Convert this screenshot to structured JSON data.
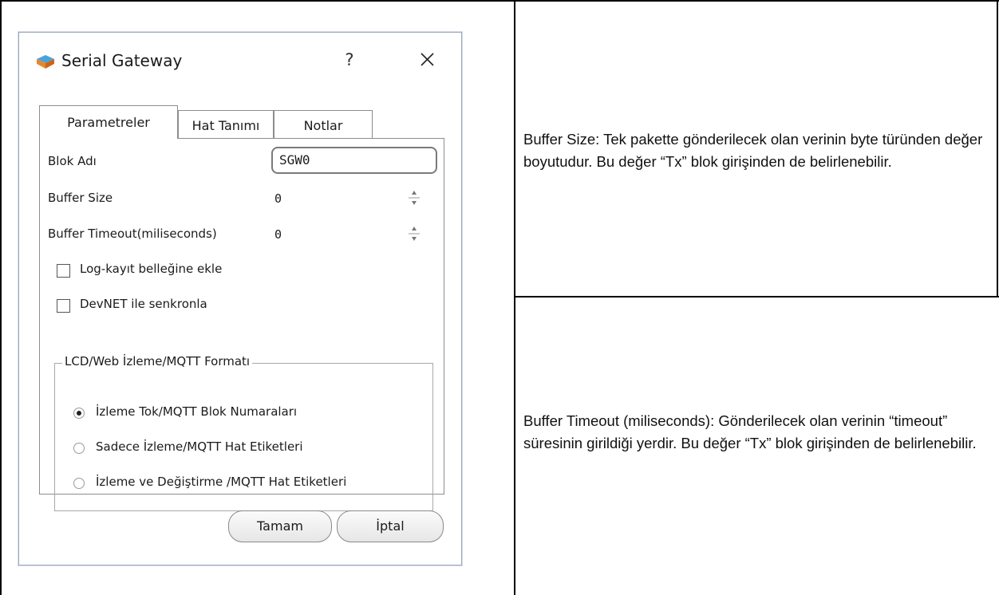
{
  "dialog": {
    "title": "Serial Gateway",
    "help_label": "?",
    "close_icon": "close-icon",
    "app_icon": "app-icon"
  },
  "tabs": [
    {
      "label": "Parametreler",
      "active": true
    },
    {
      "label": "Hat Tanımı",
      "active": false
    },
    {
      "label": "Notlar",
      "active": false
    }
  ],
  "form": {
    "block_name_label": "Blok Adı",
    "block_name_value": "SGW0",
    "buffer_size_label": "Buffer Size",
    "buffer_size_value": "0",
    "buffer_timeout_label": "Buffer Timeout(miliseconds)",
    "buffer_timeout_value": "0",
    "log_label": "Log-kayıt belleğine ekle",
    "log_checked": false,
    "devnet_label": "DevNET ile senkronla",
    "devnet_checked": false
  },
  "format_group": {
    "title": "LCD/Web İzleme/MQTT Formatı",
    "options": [
      {
        "label": "İzleme Tok/MQTT Blok Numaraları",
        "selected": true
      },
      {
        "label": "Sadece İzleme/MQTT Hat Etiketleri",
        "selected": false
      },
      {
        "label": "İzleme ve Değiştirme /MQTT Hat Etiketleri",
        "selected": false
      }
    ]
  },
  "buttons": {
    "ok_label": "Tamam",
    "cancel_label": "İptal"
  },
  "descriptions": {
    "buffer_size": "Buffer Size:  Tek pakette gönderilecek olan verinin byte türünden değer boyutudur. Bu değer “Tx” blok girişinden de belirlenebilir.",
    "buffer_timeout": "Buffer Timeout (miliseconds):  Gönderilecek olan verinin “timeout” süresinin girildiği yerdir. Bu değer “Tx” blok girişinden de belirlenebilir."
  }
}
